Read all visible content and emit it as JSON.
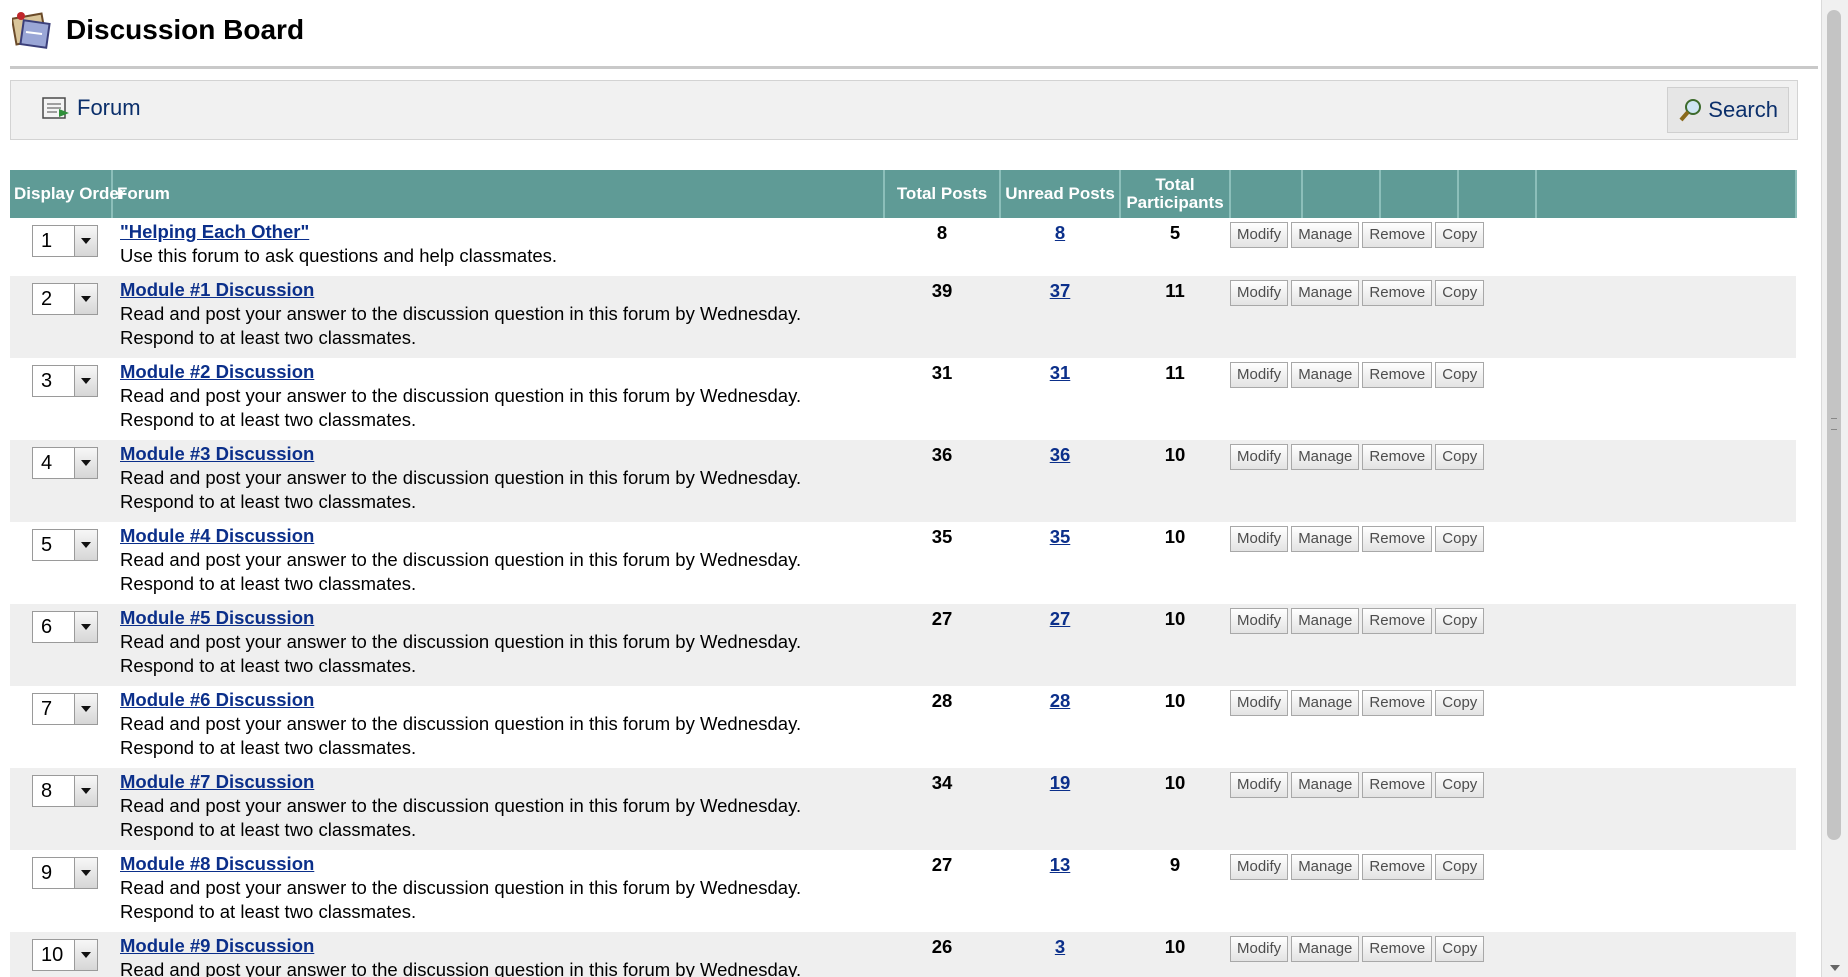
{
  "header": {
    "title": "Discussion Board"
  },
  "toolbar": {
    "forum_label": "Forum",
    "search_label": "Search"
  },
  "table": {
    "columns": {
      "display_order": "Display Order",
      "forum": "Forum",
      "total_posts": "Total Posts",
      "unread_posts": "Unread Posts",
      "total_participants": "Total Participants"
    },
    "button_labels": {
      "modify": "Modify",
      "manage": "Manage",
      "remove": "Remove",
      "copy": "Copy"
    },
    "rows": [
      {
        "order": "1",
        "name": "\"Helping Each Other\"",
        "desc": "Use this forum to ask questions and help classmates.",
        "total_posts": "8",
        "unread_posts": "8",
        "participants": "5"
      },
      {
        "order": "2",
        "name": "Module #1 Discussion",
        "desc": "Read and post your answer to the discussion question in this forum by Wednesday. Respond to at least two classmates.",
        "total_posts": "39",
        "unread_posts": "37",
        "participants": "11"
      },
      {
        "order": "3",
        "name": "Module #2 Discussion",
        "desc": "Read and post your answer to the discussion question in this forum by Wednesday. Respond to at least two classmates.",
        "total_posts": "31",
        "unread_posts": "31",
        "participants": "11"
      },
      {
        "order": "4",
        "name": "Module #3 Discussion",
        "desc": "Read and post your answer to the discussion question in this forum by Wednesday. Respond to at least two classmates.",
        "total_posts": "36",
        "unread_posts": "36",
        "participants": "10"
      },
      {
        "order": "5",
        "name": "Module #4 Discussion",
        "desc": "Read and post your answer to the discussion question in this forum by Wednesday. Respond to at least two classmates.",
        "total_posts": "35",
        "unread_posts": "35",
        "participants": "10"
      },
      {
        "order": "6",
        "name": "Module #5 Discussion",
        "desc": "Read and post your answer to the discussion question in this forum by Wednesday. Respond to at least two classmates.",
        "total_posts": "27",
        "unread_posts": "27",
        "participants": "10"
      },
      {
        "order": "7",
        "name": "Module #6 Discussion",
        "desc": "Read and post your answer to the discussion question in this forum by Wednesday. Respond to at least two classmates.",
        "total_posts": "28",
        "unread_posts": "28",
        "participants": "10"
      },
      {
        "order": "8",
        "name": "Module #7 Discussion",
        "desc": "Read and post your answer to the discussion question in this forum by Wednesday. Respond to at least two classmates.",
        "total_posts": "34",
        "unread_posts": "19",
        "participants": "10"
      },
      {
        "order": "9",
        "name": "Module #8 Discussion",
        "desc": "Read and post your answer to the discussion question in this forum by Wednesday. Respond to at least two classmates.",
        "total_posts": "27",
        "unread_posts": "13",
        "participants": "9"
      },
      {
        "order": "10",
        "name": "Module #9 Discussion",
        "desc": "Read and post your answer to the discussion question in this forum by Wednesday. Respond to at",
        "total_posts": "26",
        "unread_posts": "3",
        "participants": "10"
      }
    ]
  }
}
